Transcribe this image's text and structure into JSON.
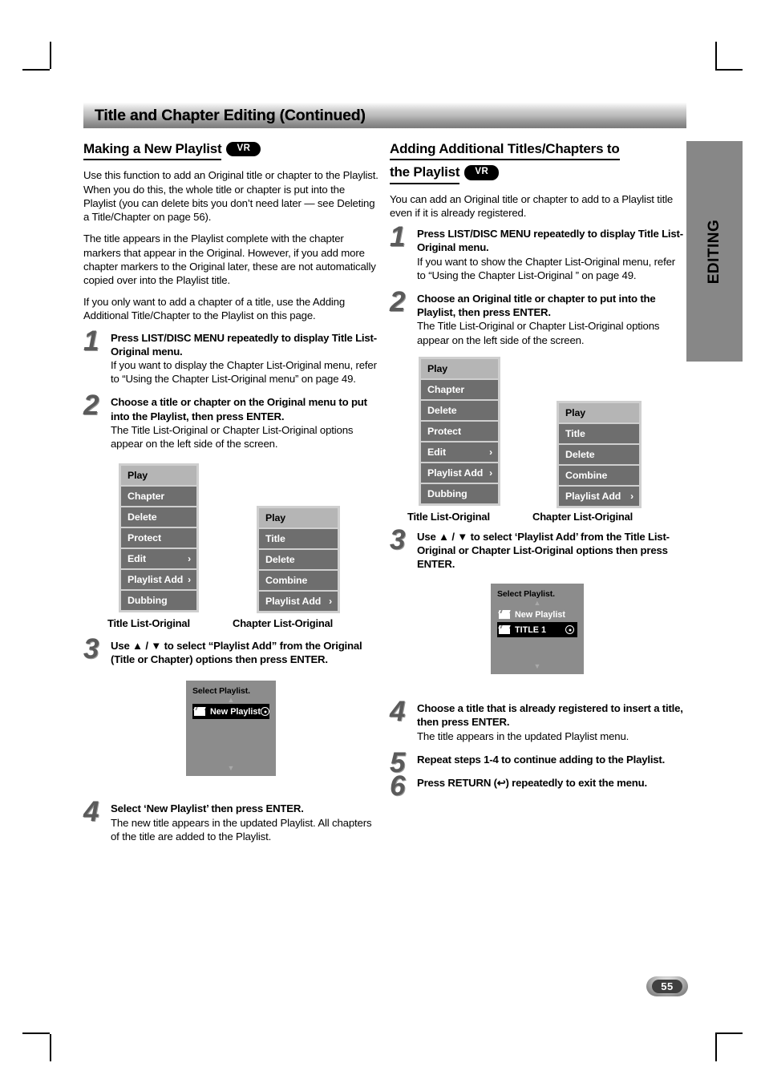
{
  "header": {
    "title": "Title and Chapter Editing (Continued)"
  },
  "side_tab": {
    "label": "EDITING"
  },
  "page_number": "55",
  "badges": {
    "vr": "VR"
  },
  "left_column": {
    "heading": "Making a New Playlist",
    "intro_paragraphs": [
      "Use this function to add an Original title or chapter to the Playlist. When you do this, the whole title or chapter is put into the Playlist (you can delete bits you don’t need later — see Deleting a Title/Chapter on page 56).",
      "The title appears in the Playlist complete with the chapter markers that appear in the Original. However, if you add more chapter markers to the Original later, these are not automatically copied over into the Playlist title.",
      "If you only want to add a chapter of a title, use the Adding Additional Title/Chapter to the Playlist on this page."
    ],
    "steps": [
      {
        "num": "1",
        "lead": "Press LIST/DISC MENU repeatedly to display Title List-Original menu.",
        "sub": "If you want to display the Chapter List-Original menu, refer to “Using the Chapter List-Original menu” on page 49."
      },
      {
        "num": "2",
        "lead": "Choose a title or chapter on the Original menu to put into the Playlist, then press ENTER.",
        "sub": "The Title List-Original or Chapter List-Original options appear on the left side of the screen."
      },
      {
        "num": "3",
        "lead": "Use ▲ / ▼ to select “Playlist Add” from the Original (Title or Chapter) options then press ENTER.",
        "sub": ""
      },
      {
        "num": "4",
        "lead": "Select ‘New Playlist’ then press ENTER.",
        "sub": "The new title appears in the updated Playlist. All chapters of the title are added to the Playlist."
      }
    ],
    "title_list_menu": {
      "caption": "Title List-Original",
      "items": [
        {
          "label": "Play",
          "selected": true,
          "arrow": ""
        },
        {
          "label": "Chapter",
          "selected": false,
          "arrow": ""
        },
        {
          "label": "Delete",
          "selected": false,
          "arrow": ""
        },
        {
          "label": "Protect",
          "selected": false,
          "arrow": ""
        },
        {
          "label": "Edit",
          "selected": false,
          "arrow": "›"
        },
        {
          "label": "Playlist Add",
          "selected": false,
          "arrow": "›"
        },
        {
          "label": "Dubbing",
          "selected": false,
          "arrow": ""
        }
      ]
    },
    "chapter_list_menu": {
      "caption": "Chapter List-Original",
      "items": [
        {
          "label": "Play",
          "selected": true,
          "arrow": ""
        },
        {
          "label": "Title",
          "selected": false,
          "arrow": ""
        },
        {
          "label": "Delete",
          "selected": false,
          "arrow": ""
        },
        {
          "label": "Combine",
          "selected": false,
          "arrow": ""
        },
        {
          "label": "Playlist Add",
          "selected": false,
          "arrow": "›"
        }
      ]
    },
    "select_playlist": {
      "title": "Select Playlist.",
      "up_arrow": "▲",
      "down_arrow": "▼",
      "rows": [
        {
          "label": "New Playlist",
          "highlighted": true,
          "has_dot": true
        }
      ]
    }
  },
  "right_column": {
    "heading_line1": "Adding Additional Titles/Chapters to",
    "heading_line2": "the Playlist",
    "intro_paragraphs": [
      "You can add an Original title or chapter to add to a Playlist title even if it is already registered."
    ],
    "steps": [
      {
        "num": "1",
        "lead": "Press LIST/DISC MENU repeatedly to display Title List-Original menu.",
        "sub": "If you want to show the Chapter List-Original menu, refer to “Using the Chapter List-Original ” on page 49."
      },
      {
        "num": "2",
        "lead": "Choose an Original title or chapter to put into the Playlist, then press ENTER.",
        "sub": "The Title List-Original or Chapter List-Original options appear on the left side of the screen."
      },
      {
        "num": "3",
        "lead": "Use ▲ / ▼ to select ‘Playlist Add’ from the Title List-Original or Chapter List-Original options then press ENTER.",
        "sub": ""
      },
      {
        "num": "4",
        "lead": "Choose a title that is already registered to insert a title, then press ENTER.",
        "sub": "The title appears in the updated Playlist menu."
      },
      {
        "num": "5",
        "lead": "Repeat steps 1-4 to continue adding to the Playlist.",
        "sub": ""
      },
      {
        "num": "6",
        "lead_before": "Press RETURN (",
        "lead_after": ") repeatedly to exit the menu.",
        "lead": "Press RETURN (↩) repeatedly to exit the menu.",
        "sub": ""
      }
    ],
    "title_list_menu": {
      "caption": "Title List-Original",
      "items": [
        {
          "label": "Play",
          "selected": true,
          "arrow": ""
        },
        {
          "label": "Chapter",
          "selected": false,
          "arrow": ""
        },
        {
          "label": "Delete",
          "selected": false,
          "arrow": ""
        },
        {
          "label": "Protect",
          "selected": false,
          "arrow": ""
        },
        {
          "label": "Edit",
          "selected": false,
          "arrow": "›"
        },
        {
          "label": "Playlist Add",
          "selected": false,
          "arrow": "›"
        },
        {
          "label": "Dubbing",
          "selected": false,
          "arrow": ""
        }
      ]
    },
    "chapter_list_menu": {
      "caption": "Chapter List-Original",
      "items": [
        {
          "label": "Play",
          "selected": true,
          "arrow": ""
        },
        {
          "label": "Title",
          "selected": false,
          "arrow": ""
        },
        {
          "label": "Delete",
          "selected": false,
          "arrow": ""
        },
        {
          "label": "Combine",
          "selected": false,
          "arrow": ""
        },
        {
          "label": "Playlist Add",
          "selected": false,
          "arrow": "›"
        }
      ]
    },
    "select_playlist": {
      "title": "Select Playlist.",
      "up_arrow": "▲",
      "down_arrow": "▼",
      "rows": [
        {
          "label": "New Playlist",
          "highlighted": false,
          "has_dot": false
        },
        {
          "label": "TITLE 1",
          "highlighted": true,
          "has_dot": true
        }
      ]
    }
  },
  "colors": {
    "menu_item_bg": "#6e6e6e",
    "menu_item_selected_bg": "#b5b5b5",
    "menu_frame": "#cfcfcf",
    "osd_box_bg": "#8c8c8c",
    "side_tab_bg": "#878787",
    "step_number": "#5a5a5a"
  }
}
